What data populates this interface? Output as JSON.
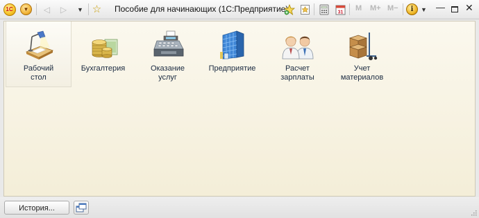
{
  "window": {
    "title": "Пособие для начинающих  (1С:Предприятие)",
    "logo_text": "1С",
    "mem_buttons": [
      "M",
      "M+",
      "M−"
    ],
    "info_glyph": "i"
  },
  "sections": [
    {
      "id": "desktop",
      "label": "Рабочий\nстол",
      "icon": "desk-lamp-icon",
      "active": true
    },
    {
      "id": "accounting",
      "label": "Бухгалтерия",
      "icon": "coins-icon",
      "active": false
    },
    {
      "id": "services",
      "label": "Оказание\nуслуг",
      "icon": "cash-register-icon",
      "active": false
    },
    {
      "id": "enterprise",
      "label": "Предприятие",
      "icon": "office-building-icon",
      "active": false
    },
    {
      "id": "payroll",
      "label": "Расчет\nзарплаты",
      "icon": "employees-icon",
      "active": false
    },
    {
      "id": "materials",
      "label": "Учет\nматериалов",
      "icon": "boxes-cart-icon",
      "active": false
    }
  ],
  "bottom": {
    "history_label": "История..."
  },
  "colors": {
    "content_bg": "#f6f1df",
    "accent": "#f2b53a"
  }
}
